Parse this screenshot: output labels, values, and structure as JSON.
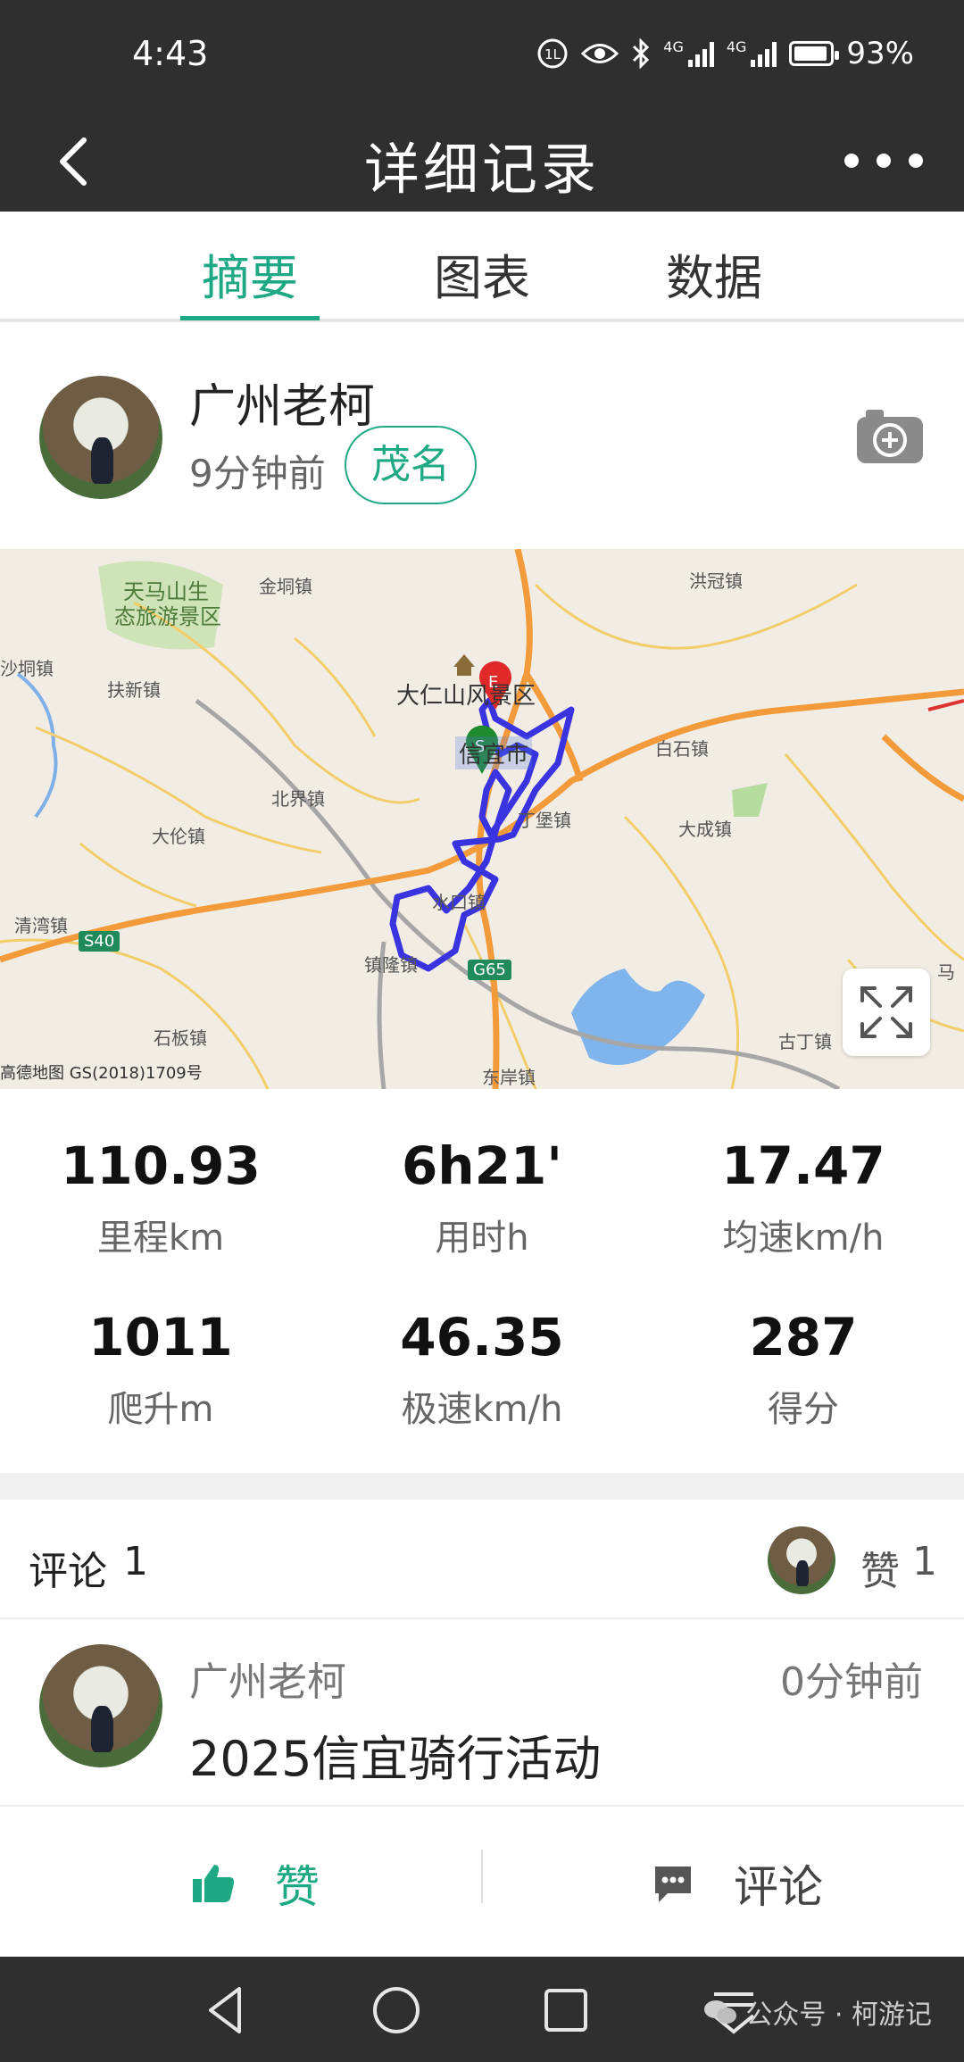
{
  "status_bar": {
    "time": "4:43",
    "network_1": "4G",
    "network_2": "4G",
    "battery": "93%",
    "battery_level": 0.93
  },
  "header": {
    "title": "详细记录"
  },
  "tabs": [
    {
      "label": "摘要",
      "active": true
    },
    {
      "label": "图表",
      "active": false
    },
    {
      "label": "数据",
      "active": false
    }
  ],
  "user": {
    "name": "广州老柯",
    "time_ago": "9分钟前",
    "city_tag": "茂名"
  },
  "map": {
    "labels": {
      "tianma": "天马山生",
      "tianma2": "态旅游景区",
      "jinbi": "金垌镇",
      "hongguan": "洪冠镇",
      "shadong": "沙垌镇",
      "fuxin": "扶新镇",
      "darenshan": "大仁山风景区",
      "city": "信宜市",
      "baishi": "白石镇",
      "beijie": "北界镇",
      "dingbao": "丁堡镇",
      "dalun": "大伦镇",
      "dacheng": "大成镇",
      "shuikou": "水口镇",
      "qingwan": "清湾镇",
      "zhenlong": "镇隆镇",
      "shiban": "石板镇",
      "dongan": "东岸镇",
      "guding": "古丁镇",
      "ma": "马",
      "s40": "S40",
      "g65": "G65",
      "copyright": "高德地图 GS(2018)1709号",
      "bottom_left": "镇"
    },
    "markers": {
      "start": "S",
      "end": "E"
    }
  },
  "stats": [
    {
      "value": "110.93",
      "label": "里程km"
    },
    {
      "value": "6h21'",
      "label": "用时h"
    },
    {
      "value": "17.47",
      "label": "均速km/h"
    },
    {
      "value": "1011",
      "label": "爬升m"
    },
    {
      "value": "46.35",
      "label": "极速km/h"
    },
    {
      "value": "287",
      "label": "得分"
    }
  ],
  "comments_section": {
    "label": "评论",
    "count": "1",
    "likes_label": "赞",
    "likes_count": "1"
  },
  "comment": {
    "author": "广州老柯",
    "time": "0分钟前",
    "text": "2025信宜骑行活动"
  },
  "actions": {
    "like": "赞",
    "comment": "评论"
  },
  "watermark": "公众号 · 柯游记",
  "colors": {
    "accent": "#1ea884",
    "dark_bar": "#2f2f2f",
    "route": "#3a34e0"
  }
}
